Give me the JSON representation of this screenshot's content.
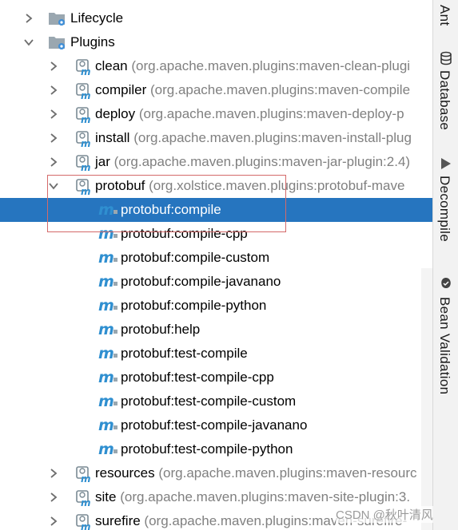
{
  "tree": {
    "lifecycle_label": "Lifecycle",
    "plugins_label": "Plugins",
    "plugins": [
      {
        "name": "clean",
        "meta": "(org.apache.maven.plugins:maven-clean-plugi"
      },
      {
        "name": "compiler",
        "meta": "(org.apache.maven.plugins:maven-compile"
      },
      {
        "name": "deploy",
        "meta": "(org.apache.maven.plugins:maven-deploy-p"
      },
      {
        "name": "install",
        "meta": "(org.apache.maven.plugins:maven-install-plug"
      },
      {
        "name": "jar",
        "meta": "(org.apache.maven.plugins:maven-jar-plugin:2.4)"
      },
      {
        "name": "protobuf",
        "meta": "(org.xolstice.maven.plugins:protobuf-mave"
      }
    ],
    "goals": [
      "protobuf:compile",
      "protobuf:compile-cpp",
      "protobuf:compile-custom",
      "protobuf:compile-javanano",
      "protobuf:compile-python",
      "protobuf:help",
      "protobuf:test-compile",
      "protobuf:test-compile-cpp",
      "protobuf:test-compile-custom",
      "protobuf:test-compile-javanano",
      "protobuf:test-compile-python"
    ],
    "selected_goal": "protobuf:compile",
    "more_plugins": [
      {
        "name": "resources",
        "meta": "(org.apache.maven.plugins:maven-resourc"
      },
      {
        "name": "site",
        "meta": "(org.apache.maven.plugins:maven-site-plugin:3."
      },
      {
        "name": "surefire",
        "meta": "(org.apache.maven.plugins:maven-surefire-"
      }
    ]
  },
  "side_tabs": [
    {
      "label": "Ant",
      "icon": "ant-icon"
    },
    {
      "label": "Database",
      "icon": "database-icon"
    },
    {
      "label": "Decompile",
      "icon": "decompile-icon"
    },
    {
      "label": "Bean Validation",
      "icon": "bean-validation-icon"
    }
  ],
  "watermark": "CSDN @秋叶清风",
  "colors": {
    "selection": "#2675bf",
    "meta_text": "#808080",
    "annotation_box": "#d46a6a",
    "maven_icon_blue": "#2f8fd0"
  }
}
